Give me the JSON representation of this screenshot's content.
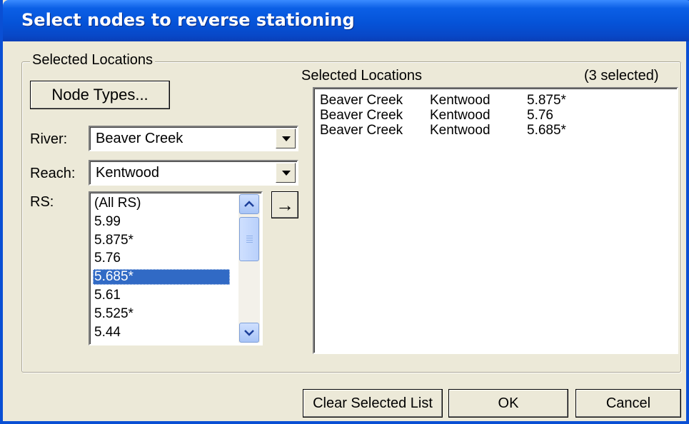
{
  "window": {
    "title": "Select nodes to reverse stationing"
  },
  "group": {
    "legend": "Selected Locations"
  },
  "left": {
    "node_types_label": "Node Types...",
    "river_label": "River:",
    "river_value": "Beaver Creek",
    "reach_label": "Reach:",
    "reach_value": "Kentwood",
    "rs_label": "RS:",
    "rs_items": [
      "(All RS)",
      "5.99",
      "5.875*",
      "5.76",
      "5.685*",
      "5.61",
      "5.525*",
      "5.44"
    ],
    "rs_selected": "5.685*",
    "add_arrow": "→"
  },
  "right": {
    "header": "Selected Locations",
    "count": "(3 selected)",
    "rows": [
      {
        "river": "Beaver Creek",
        "reach": "Kentwood",
        "rs": "5.875*"
      },
      {
        "river": "Beaver Creek",
        "reach": "Kentwood",
        "rs": "5.76"
      },
      {
        "river": "Beaver Creek",
        "reach": "Kentwood",
        "rs": "5.685*"
      }
    ]
  },
  "footer": {
    "clear_label": "Clear Selected List",
    "ok_label": "OK",
    "cancel_label": "Cancel"
  },
  "colors": {
    "titlebar": "#0553d8",
    "selection": "#316ac5",
    "dialog": "#ece9d8"
  },
  "icons": {
    "add": "right-arrow-icon",
    "scroll_up": "chevron-up-icon",
    "scroll_down": "chevron-down-icon",
    "combo": "dropdown-arrow-icon"
  }
}
